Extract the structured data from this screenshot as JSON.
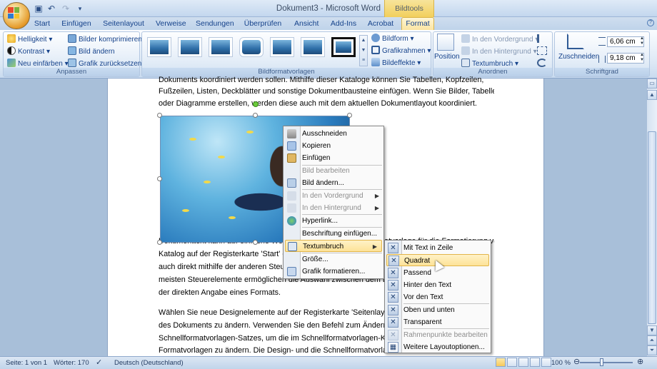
{
  "window": {
    "title": "Dokument3 - Microsoft Word",
    "context_group": "Bildtools"
  },
  "quick_access": [
    "save-icon",
    "undo-icon",
    "redo-icon",
    "customize-icon"
  ],
  "tabs": [
    "Start",
    "Einfügen",
    "Seitenlayout",
    "Verweise",
    "Sendungen",
    "Überprüfen",
    "Ansicht",
    "Add-Ins",
    "Acrobat",
    "Format"
  ],
  "active_tab": "Format",
  "ribbon": {
    "anpassen": {
      "label": "Anpassen",
      "helligkeit": "Helligkeit",
      "kontrast": "Kontrast",
      "neu_einfaerben": "Neu einfärben",
      "komprimieren": "Bilder komprimieren",
      "bild_aendern": "Bild ändern",
      "zuruecksetzen": "Grafik zurücksetzen"
    },
    "bildformatvorlagen": {
      "label": "Bildformatvorlagen",
      "bildform": "Bildform",
      "bildrahmen": "Grafikrahmen",
      "bildeffekte": "Bildeffekte"
    },
    "anordnen": {
      "label": "Anordnen",
      "position": "Position",
      "vordergrund": "In den Vordergrund",
      "hintergrund": "In den Hintergrund",
      "textumbruch": "Textumbruch"
    },
    "schriftgrad": {
      "label": "Schriftgrad",
      "zuschneiden": "Zuschneiden",
      "height": "6,06 cm",
      "width": "9,18 cm"
    }
  },
  "document": {
    "lines_top": [
      "Dokuments koordiniert werden sollen. Mithilfe dieser Kataloge können Sie Tabellen, Kopfzeilen,",
      "Fußzeilen, Listen, Deckblätter und sonstige Dokumentbausteine einfügen. Wenn Sie Bilder, Tabellen",
      "oder Diagramme erstellen, werden diese auch mit dem aktuellen Dokumentlayout koordiniert."
    ],
    "lines_mid": [
      "Dokumenttext kann auf einfache Weise durch Auswahl einer Formatvorlage für die Formatierung von markiertem Text im",
      "Katalog auf der Registerkarte 'Start' ein Aussehen geben. Sie können Text",
      "auch direkt mithilfe der anderen Steuerelemente auf der Registerkarte 'Start' formatieren. Die",
      "meisten Steuerelemente ermöglichen die Auswahl zwischen dem Layout des aktuellen Designs oder",
      "der direkten Angabe eines Formats."
    ],
    "lines_bottom": [
      "Wählen Sie neue Designelemente auf der Registerkarte 'Seitenlayout', um das Aussehen",
      "des Dokuments zu ändern. Verwenden Sie den Befehl zum Ändern des aktuellen",
      "Schnellformatvorlagen-Satzes, um die im Schnellformatvorlagen-Katalog verfügbaren",
      "Formatvorlagen zu ändern. Die Design- und die Schnellformatvorlagen-Kataloge"
    ]
  },
  "context_menu": [
    {
      "label": "Ausschneiden",
      "enabled": true,
      "icon": "scissors-icon"
    },
    {
      "label": "Kopieren",
      "enabled": true,
      "icon": "copy-icon"
    },
    {
      "label": "Einfügen",
      "enabled": true,
      "icon": "paste-icon"
    },
    {
      "label": "Bild bearbeiten",
      "enabled": false,
      "icon": ""
    },
    {
      "label": "Bild ändern...",
      "enabled": true,
      "icon": "change-picture-icon"
    },
    {
      "label": "In den Vordergrund",
      "enabled": false,
      "icon": "bring-forward-icon",
      "submenu": true
    },
    {
      "label": "In den Hintergrund",
      "enabled": false,
      "icon": "send-backward-icon",
      "submenu": true
    },
    {
      "label": "Hyperlink...",
      "enabled": true,
      "icon": "hyperlink-icon"
    },
    {
      "label": "Beschriftung einfügen...",
      "enabled": true,
      "icon": ""
    },
    {
      "label": "Textumbruch",
      "enabled": true,
      "icon": "text-wrap-icon",
      "submenu": true,
      "highlighted": true
    },
    {
      "label": "Größe...",
      "enabled": true,
      "icon": ""
    },
    {
      "label": "Grafik formatieren...",
      "enabled": true,
      "icon": "format-picture-icon"
    }
  ],
  "submenu": [
    {
      "label": "Mit Text in Zeile",
      "enabled": true
    },
    {
      "label": "Quadrat",
      "enabled": true,
      "highlighted": true
    },
    {
      "label": "Passend",
      "enabled": true
    },
    {
      "label": "Hinter den Text",
      "enabled": true
    },
    {
      "label": "Vor den Text",
      "enabled": true
    },
    {
      "label": "Oben und unten",
      "enabled": true
    },
    {
      "label": "Transparent",
      "enabled": true
    },
    {
      "label": "Rahmenpunkte bearbeiten",
      "enabled": false
    },
    {
      "label": "Weitere Layoutoptionen...",
      "enabled": true
    }
  ],
  "status": {
    "page": "Seite: 1 von 1",
    "words": "Wörter: 170",
    "language": "Deutsch (Deutschland)",
    "zoom": "100 %"
  }
}
